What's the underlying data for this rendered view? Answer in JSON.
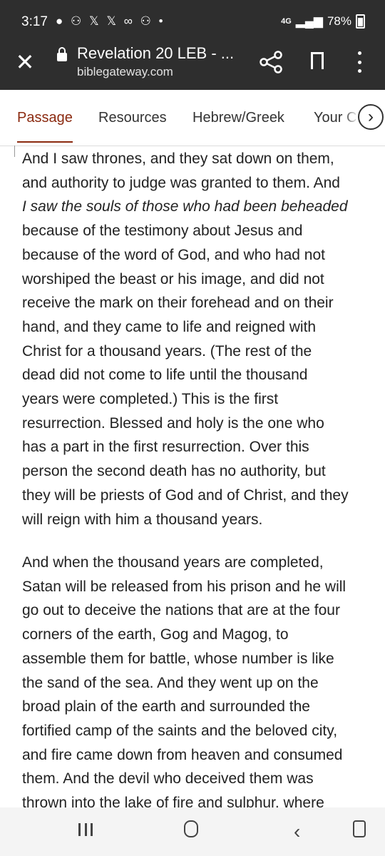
{
  "status_bar": {
    "time": "3:17",
    "notification_icons": "● ⚇ 𝕏 𝕏 ∞ ⚇ •",
    "network": "4G",
    "battery": "78%"
  },
  "app_bar": {
    "title": "Revelation 20 LEB - ...",
    "url": "biblegateway.com"
  },
  "tabs": [
    {
      "label": "Passage"
    },
    {
      "label": "Resources"
    },
    {
      "label": "Hebrew/Greek"
    },
    {
      "label": "Your C"
    }
  ],
  "passage": {
    "p1_lines": [
      "And I saw thrones, and they sat down on them,",
      "and authority to judge was granted to them. And",
      "I saw the souls of those who had been beheaded",
      "because of the testimony about Jesus and",
      "because of the word of God, and who had not",
      "worshiped the beast or his image, and did not",
      "receive the mark on their forehead and on their",
      "hand, and they came to life and reigned with",
      "Christ for a thousand years. (The rest of the",
      "dead did not come to life until the thousand",
      "years were completed.) This is the first",
      "resurrection. Blessed and holy is the one who",
      "has a part in the first resurrection. Over this",
      "person the second death has no authority, but",
      "they will be priests of God and of Christ, and they",
      "will reign with him a thousand years."
    ],
    "p2_lines": [
      "And when the thousand years are completed,",
      "Satan will be released from his prison and he will",
      "go out to deceive the nations that are at the four",
      "corners of the earth, Gog and Magog, to",
      "assemble them for battle, whose number is like",
      "the sand of the sea. And they went up on the",
      "broad plain of the earth and surrounded the",
      "fortified camp of the saints and the beloved city,",
      "and fire came down from heaven and consumed",
      "them. And the devil who deceived them was",
      "thrown into the lake of fire and sulphur, where"
    ]
  },
  "colors": {
    "app_bar_bg": "#2e2e2e",
    "active_tab": "#8b2a10"
  }
}
